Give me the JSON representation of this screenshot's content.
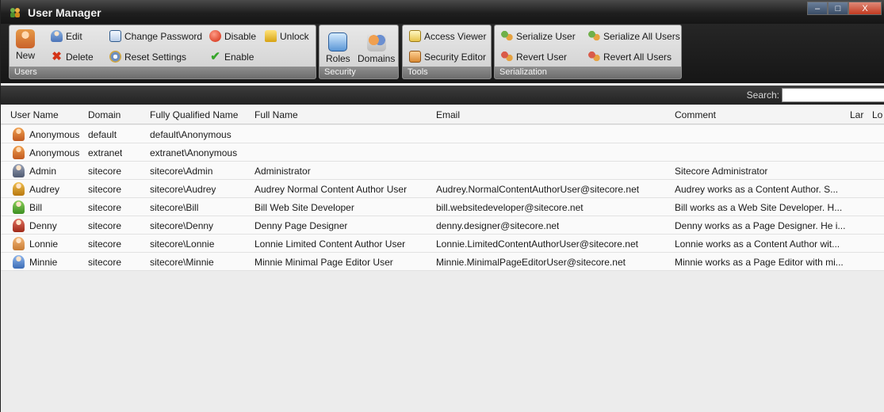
{
  "window": {
    "title": "User Manager",
    "buttons": {
      "minimize": "–",
      "maximize": "□",
      "close": "X"
    }
  },
  "ribbon": {
    "users": {
      "label": "Users",
      "new": "New",
      "edit": "Edit",
      "delete": "Delete",
      "change_password": "Change Password",
      "reset_settings": "Reset Settings",
      "disable": "Disable",
      "enable": "Enable",
      "unlock": "Unlock"
    },
    "security": {
      "label": "Security",
      "roles": "Roles",
      "domains": "Domains"
    },
    "tools": {
      "label": "Tools",
      "access_viewer": "Access Viewer",
      "security_editor": "Security Editor"
    },
    "serialization": {
      "label": "Serialization",
      "serialize_user": "Serialize User",
      "serialize_all_users": "Serialize All Users",
      "revert_user": "Revert User",
      "revert_all_users": "Revert All Users"
    }
  },
  "search": {
    "label": "Search:",
    "value": ""
  },
  "table": {
    "columns": {
      "user_name": "User Name",
      "domain": "Domain",
      "fqn": "Fully Qualified Name",
      "full_name": "Full Name",
      "email": "Email",
      "comment": "Comment",
      "lang": "Lar",
      "locked": "Lo"
    },
    "rows": [
      {
        "icon": "anonymous-user-icon",
        "user": "Anonymous",
        "domain": "default",
        "fqn": "default\\Anonymous",
        "full": "",
        "email": "",
        "comment": ""
      },
      {
        "icon": "anonymous-user-icon",
        "user": "Anonymous",
        "domain": "extranet",
        "fqn": "extranet\\Anonymous",
        "full": "",
        "email": "",
        "comment": ""
      },
      {
        "icon": "admin-user-icon",
        "user": "Admin",
        "domain": "sitecore",
        "fqn": "sitecore\\Admin",
        "full": "Administrator",
        "email": "",
        "comment": "Sitecore Administrator"
      },
      {
        "icon": "author-user-icon",
        "user": "Audrey",
        "domain": "sitecore",
        "fqn": "sitecore\\Audrey",
        "full": "Audrey Normal Content Author User",
        "email": "Audrey.NormalContentAuthorUser@sitecore.net",
        "comment": "Audrey works as a Content Author. S..."
      },
      {
        "icon": "developer-user-icon",
        "user": "Bill",
        "domain": "sitecore",
        "fqn": "sitecore\\Bill",
        "full": "Bill Web Site Developer",
        "email": "bill.websitedeveloper@sitecore.net",
        "comment": "Bill works as a Web Site Developer. H..."
      },
      {
        "icon": "designer-user-icon",
        "user": "Denny",
        "domain": "sitecore",
        "fqn": "sitecore\\Denny",
        "full": "Denny Page Designer",
        "email": "denny.designer@sitecore.net",
        "comment": "Denny works as a Page Designer. He i..."
      },
      {
        "icon": "limited-author-user-icon",
        "user": "Lonnie",
        "domain": "sitecore",
        "fqn": "sitecore\\Lonnie",
        "full": "Lonnie Limited Content Author User",
        "email": "Lonnie.LimitedContentAuthorUser@sitecore.net",
        "comment": "Lonnie works as a Content Author wit..."
      },
      {
        "icon": "editor-user-icon",
        "user": "Minnie",
        "domain": "sitecore",
        "fqn": "sitecore\\Minnie",
        "full": "Minnie Minimal Page Editor User",
        "email": "Minnie.MinimalPageEditorUser@sitecore.net",
        "comment": "Minnie works as a Page Editor with mi..."
      }
    ]
  }
}
